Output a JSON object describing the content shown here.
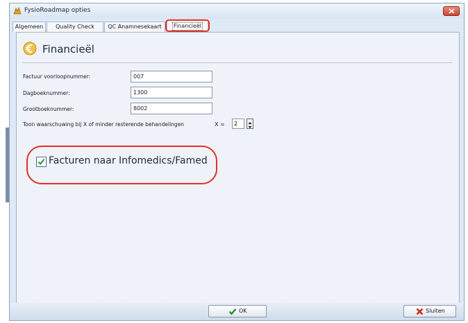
{
  "window": {
    "title": "FysioRoadmap opties"
  },
  "tabs": [
    {
      "label": "Algemeen"
    },
    {
      "label": "Quality Check"
    },
    {
      "label": "QC Anamnesekaart"
    },
    {
      "label": "Financieël",
      "active": true
    }
  ],
  "header": {
    "title": "Financieël",
    "icon": "euro-icon"
  },
  "fields": {
    "factuur": {
      "label": "Factuur voorloopnummer:",
      "value": "007"
    },
    "dagboek": {
      "label": "Dagboeknummer:",
      "value": "1300"
    },
    "grootboek": {
      "label": "Grootboeknummer:",
      "value": "8002"
    }
  },
  "warning": {
    "label": "Toon waarschuwing bij X of minder resterende behandelingen",
    "x_label": "X =",
    "value": "2"
  },
  "infomedics": {
    "label": "Facturen naar Infomedics/Famed",
    "checked": true
  },
  "buttons": {
    "ok": "OK",
    "close": "Sluiten"
  },
  "colors": {
    "highlight": "#e0302a",
    "check": "#2e8b2e",
    "close_icon": "#d0281c",
    "euro": "#e8a317"
  }
}
